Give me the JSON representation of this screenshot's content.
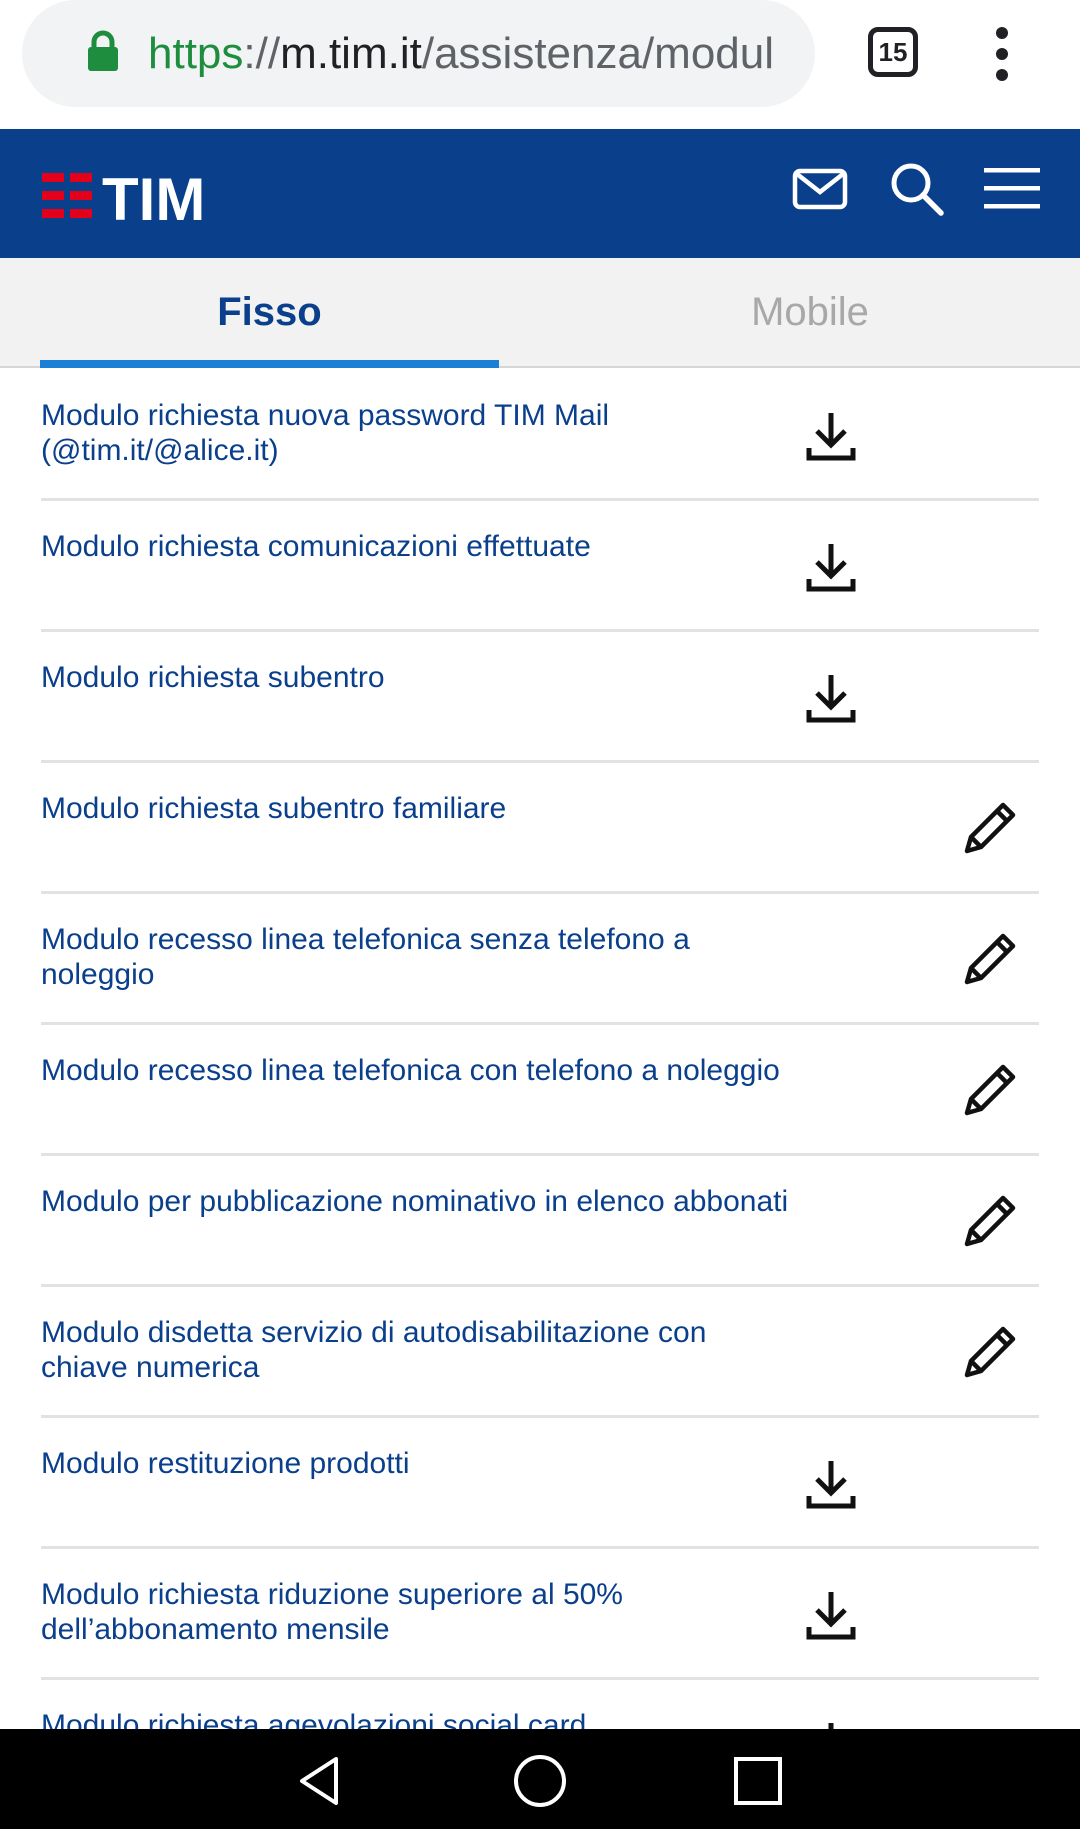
{
  "browser": {
    "url_scheme": "https",
    "url_sep": "://",
    "url_host": "m.tim.it",
    "url_path": "/assistenza/modul",
    "tab_count": "15"
  },
  "header": {
    "logo_text": "TIM",
    "brand_color": "#0a3f8c",
    "logo_red": "#e2001a"
  },
  "tabs": [
    {
      "label": "Fisso",
      "active": true
    },
    {
      "label": "Mobile",
      "active": false
    }
  ],
  "modules": [
    {
      "label": "Modulo richiesta nuova password TIM Mail (@tim.it/@alice.it)",
      "action": "download"
    },
    {
      "label": "Modulo richiesta comunicazioni effettuate",
      "action": "download"
    },
    {
      "label": "Modulo richiesta subentro",
      "action": "download"
    },
    {
      "label": "Modulo richiesta subentro familiare",
      "action": "edit"
    },
    {
      "label": "Modulo recesso linea telefonica senza telefono a noleggio",
      "action": "edit"
    },
    {
      "label": "Modulo recesso linea telefonica con telefono a noleggio",
      "action": "edit"
    },
    {
      "label": "Modulo per pubblicazione nominativo in elenco abbonati",
      "action": "edit"
    },
    {
      "label": "Modulo disdetta servizio di autodisabilitazione con chiave numerica",
      "action": "edit"
    },
    {
      "label": "Modulo restituzione prodotti",
      "action": "download"
    },
    {
      "label": "Modulo richiesta riduzione superiore al 50% dell’abbonamento mensile",
      "action": "download"
    },
    {
      "label": "Modulo richiesta agevolazioni social card",
      "action": "download"
    }
  ]
}
